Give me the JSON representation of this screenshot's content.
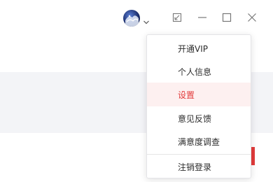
{
  "titlebar": {
    "avatar_icon": "user-avatar",
    "dropdown_icon": "chevron-down-icon",
    "restore_icon": "restore-window-icon",
    "minimize_icon": "minimize-icon",
    "maximize_icon": "maximize-icon",
    "close_icon": "close-icon"
  },
  "menu": {
    "items": [
      {
        "label": "开通VIP"
      },
      {
        "label": "个人信息"
      },
      {
        "label": "设置",
        "active": true
      },
      {
        "label": "意见反馈"
      },
      {
        "label": "满意度调查"
      },
      {
        "label": "注销登录"
      }
    ]
  },
  "colors": {
    "accent": "#e23b3b",
    "active_bg": "#fdf0f0",
    "band": "#f3f4f7"
  }
}
